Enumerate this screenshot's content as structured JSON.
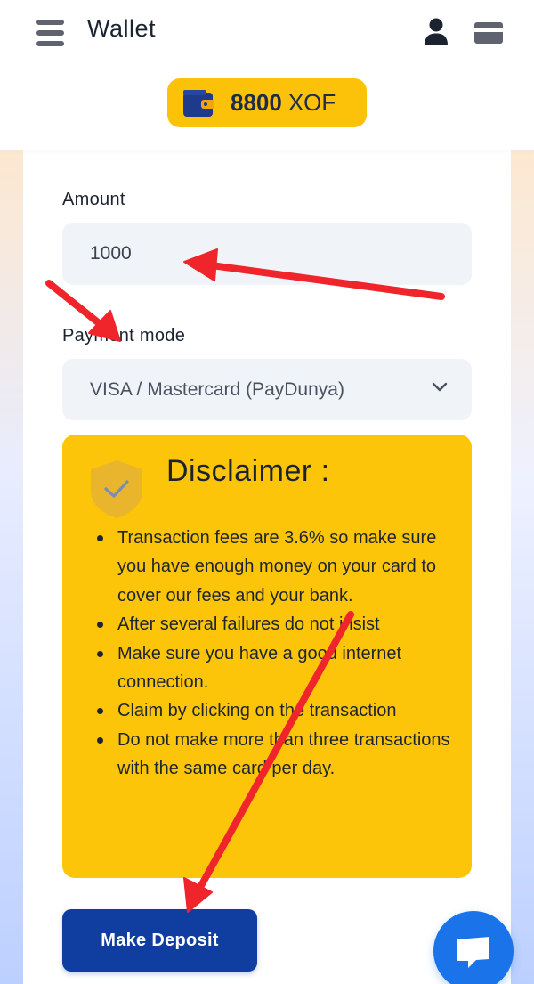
{
  "header": {
    "title": "Wallet",
    "menu_icon": "hamburger-menu-icon",
    "user_icon": "user-icon",
    "card_icon": "credit-card-icon"
  },
  "balance": {
    "amount": "8800",
    "currency": "XOF",
    "icon": "wallet-icon"
  },
  "form": {
    "amount_label": "Amount",
    "amount_value": "1000",
    "payment_mode_label": "Payment mode",
    "payment_mode_value": "VISA / Mastercard (PayDunya)"
  },
  "disclaimer": {
    "title": "Disclaimer :",
    "items": [
      "Transaction fees are 3.6% so make sure you have enough money on your card to cover our fees and your bank.",
      "After several failures do not insist",
      "Make sure you have a good internet connection.",
      "Claim by clicking on the transaction",
      "Do not make more than three transactions with the same card per day."
    ]
  },
  "actions": {
    "deposit_label": "Make Deposit",
    "chat_icon": "chat-bubble-icon"
  },
  "colors": {
    "accent_yellow": "#fcc509",
    "primary_blue": "#0f3ea0",
    "chat_blue": "#1a73e8",
    "annotation_red": "#f0242b"
  }
}
